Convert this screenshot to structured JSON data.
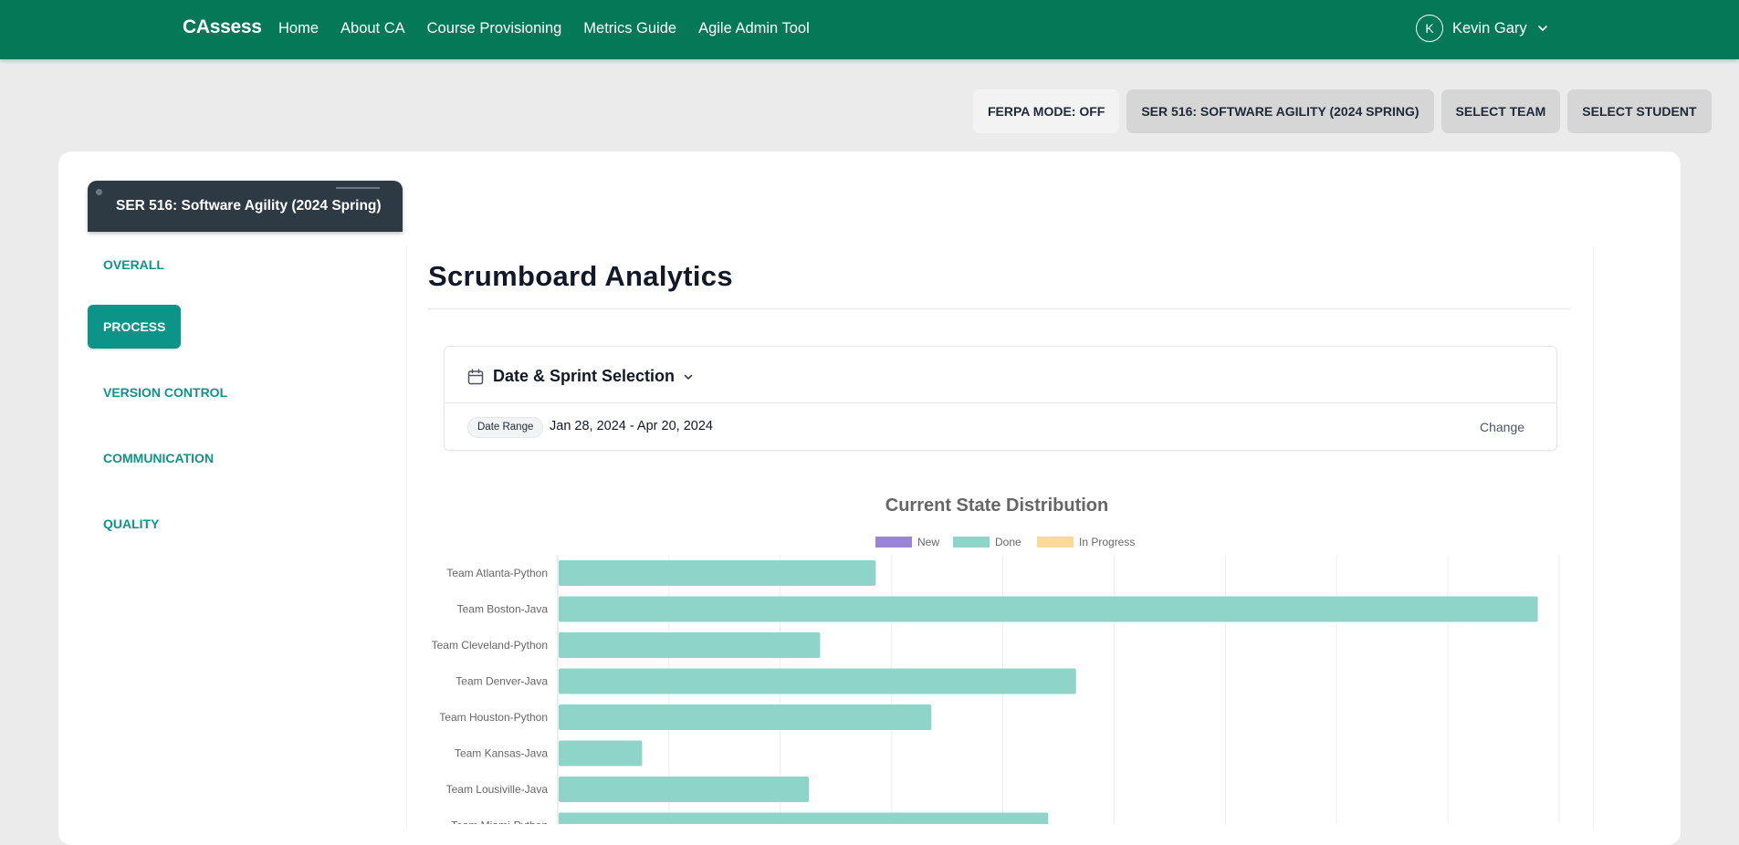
{
  "navbar": {
    "brand": "CAssess",
    "links": [
      "Home",
      "About CA",
      "Course Provisioning",
      "Metrics Guide",
      "Agile Admin Tool"
    ],
    "user_initial": "K",
    "user_name": "Kevin Gary"
  },
  "topbar": {
    "ferpa": "FERPA MODE: OFF",
    "course": "SER 516: SOFTWARE AGILITY (2024 SPRING)",
    "team": "SELECT TEAM",
    "student": "SELECT STUDENT"
  },
  "sidebar": {
    "course_title": "SER 516: Software Agility (2024 Spring)",
    "items": [
      "OVERALL",
      "PROCESS",
      "VERSION CONTROL",
      "COMMUNICATION",
      "QUALITY"
    ],
    "active": "PROCESS"
  },
  "page": {
    "title": "Scrumboard Analytics"
  },
  "filter": {
    "heading": "Date & Sprint Selection",
    "pill": "Date Range",
    "range": "Jan 28, 2024 - Apr 20, 2024",
    "change": "Change"
  },
  "colors": {
    "nav": "#047857",
    "accent": "#0d9488",
    "new": "#9b84d6",
    "done": "#8fd4c8",
    "in_progress": "#fbd99a"
  },
  "chart_data": {
    "type": "bar",
    "orientation": "horizontal",
    "stacked": true,
    "title": "Current State Distribution",
    "legend": [
      "New",
      "Done",
      "In Progress"
    ],
    "legend_position": "top",
    "categories": [
      "Team Atlanta-Python",
      "Team Boston-Java",
      "Team Cleveland-Python",
      "Team Denver-Java",
      "Team Houston-Python",
      "Team Kansas-Java",
      "Team Lousiville-Java",
      "Team Miami-Python"
    ],
    "series": [
      {
        "name": "New",
        "values": [
          0,
          0,
          0,
          0,
          0,
          0,
          0,
          0
        ]
      },
      {
        "name": "Done",
        "values": [
          57,
          176,
          47,
          93,
          67,
          15,
          45,
          88
        ]
      },
      {
        "name": "In Progress",
        "values": [
          0,
          0,
          0,
          0,
          0,
          0,
          0,
          0
        ]
      }
    ],
    "xlim": [
      0,
      180
    ],
    "grid": true
  }
}
